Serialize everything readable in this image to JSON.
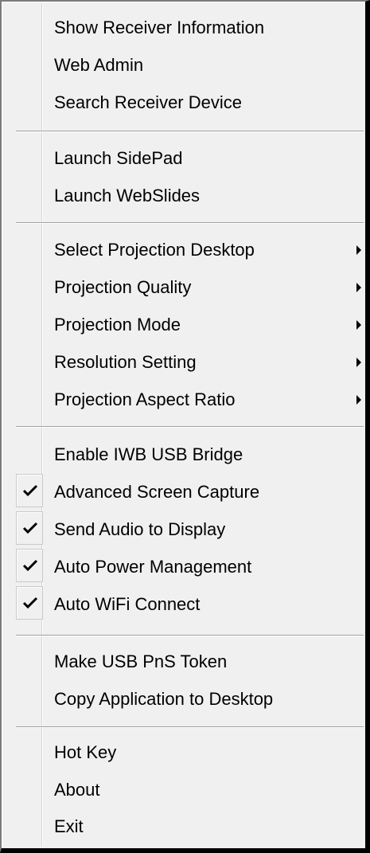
{
  "menu": {
    "items": [
      {
        "label": "Show Receiver Information"
      },
      {
        "label": "Web Admin"
      },
      {
        "label": "Search Receiver Device"
      },
      {
        "label": "Launch SidePad"
      },
      {
        "label": "Launch WebSlides"
      },
      {
        "label": "Select Projection Desktop",
        "submenu": true
      },
      {
        "label": "Projection Quality",
        "submenu": true
      },
      {
        "label": "Projection Mode",
        "submenu": true
      },
      {
        "label": "Resolution Setting",
        "submenu": true
      },
      {
        "label": "Projection Aspect Ratio",
        "submenu": true
      },
      {
        "label": "Enable IWB USB Bridge",
        "checked": false
      },
      {
        "label": "Advanced Screen Capture",
        "checked": true
      },
      {
        "label": "Send Audio to Display",
        "checked": true
      },
      {
        "label": "Auto Power Management",
        "checked": true
      },
      {
        "label": "Auto WiFi Connect",
        "checked": true
      },
      {
        "label": "Make USB PnS Token"
      },
      {
        "label": "Copy Application to Desktop"
      },
      {
        "label": "Hot Key"
      },
      {
        "label": "About"
      },
      {
        "label": "Exit"
      }
    ]
  }
}
